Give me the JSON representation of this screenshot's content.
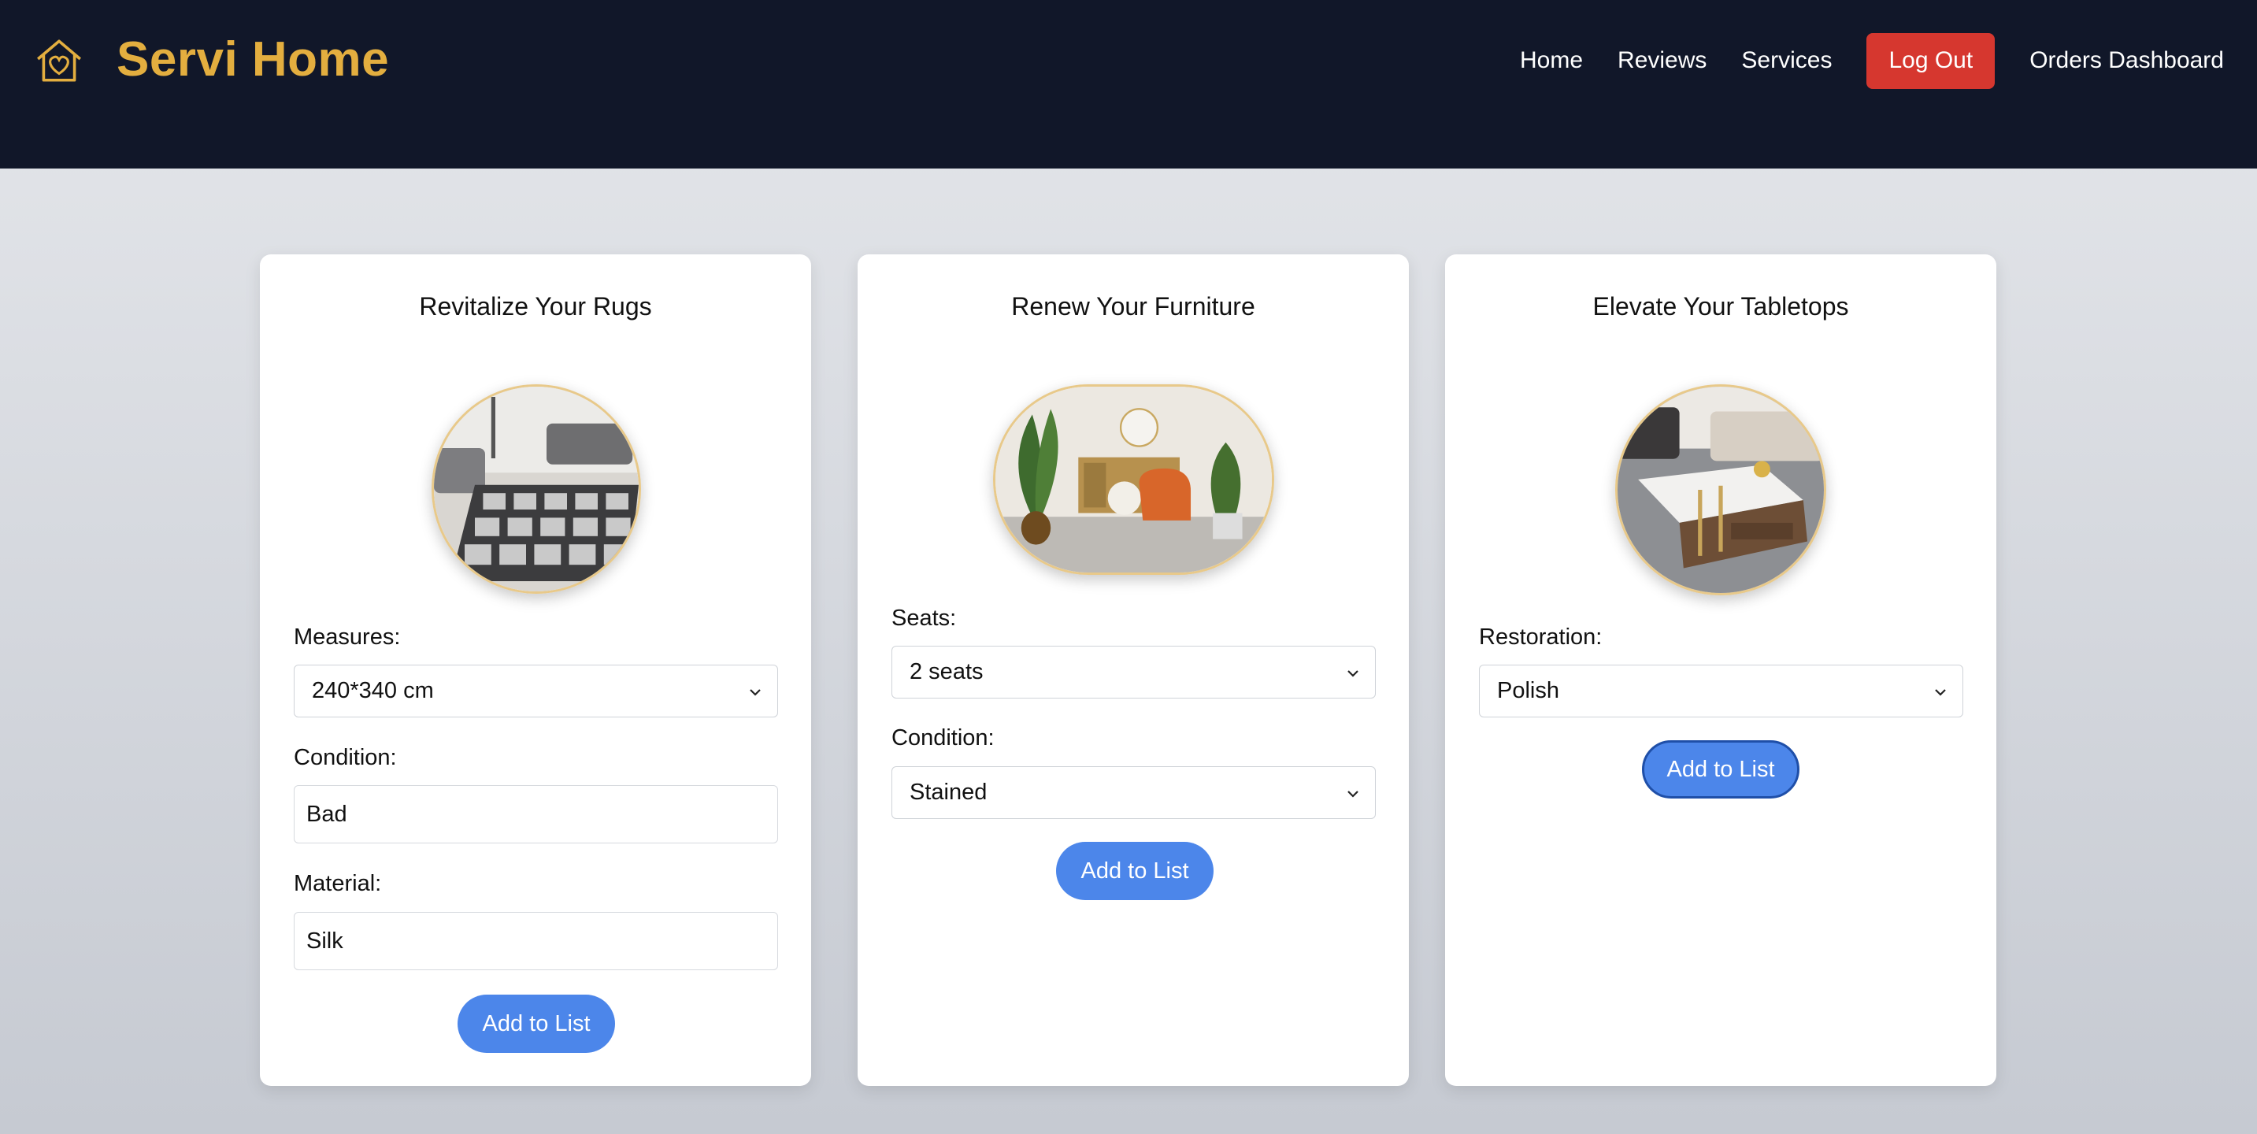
{
  "header": {
    "brand": "Servi Home",
    "logo_icon": "house-heart-icon",
    "nav": {
      "home": "Home",
      "reviews": "Reviews",
      "services": "Services",
      "logout": "Log Out",
      "orders": "Orders Dashboard"
    }
  },
  "colors": {
    "header_bg": "#111729",
    "brand": "#e3ae3f",
    "logout": "#d6372f",
    "button": "#4c86ea"
  },
  "cards": {
    "rugs": {
      "title": "Revitalize Your Rugs",
      "image_icon": "rug-photo",
      "measures_label": "Measures:",
      "measures_value": "240*340 cm",
      "condition_label": "Condition:",
      "condition_value": "Bad",
      "material_label": "Material:",
      "material_value": "Silk",
      "button": "Add to List"
    },
    "furniture": {
      "title": "Renew Your Furniture",
      "image_icon": "furniture-photo",
      "seats_label": "Seats:",
      "seats_value": "2 seats",
      "condition_label": "Condition:",
      "condition_value": "Stained",
      "button": "Add to List"
    },
    "tabletops": {
      "title": "Elevate Your Tabletops",
      "image_icon": "tabletop-photo",
      "restoration_label": "Restoration:",
      "restoration_value": "Polish",
      "button": "Add to List"
    }
  }
}
